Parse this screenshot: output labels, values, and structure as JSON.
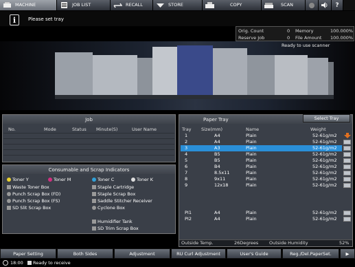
{
  "tabs": [
    {
      "label": "MACHINE"
    },
    {
      "label": "JOB LIST"
    },
    {
      "label": "RECALL"
    },
    {
      "label": "STORE"
    },
    {
      "label": "COPY"
    },
    {
      "label": "SCAN"
    }
  ],
  "message": "Please set tray",
  "counts": {
    "orig_label": "Orig. Count",
    "orig_value": "0",
    "reserve_label": "Reserve Job",
    "reserve_value": "0",
    "memory_label": "Memory",
    "memory_value": "100.000%",
    "file_label": "File Amount",
    "file_value": "100.000%"
  },
  "scanner_status": "Ready to use scanner",
  "job": {
    "title": "Job",
    "headers": [
      "No.",
      "Mode",
      "Status",
      "Minute(S)",
      "User Name"
    ]
  },
  "consumables": {
    "title": "Consumable and Scrap Indicators",
    "items": [
      "Toner Y",
      "Toner M",
      "Toner C",
      "Toner K",
      "Waste Toner Box",
      "Staple Cartridge",
      "Punch Scrap Box (FD)",
      "Staple Scrap Box",
      "Punch Scrap Box (FS)",
      "Saddle Stitcher Receiver",
      "SD Slit Scrap Box",
      "Cyclone Box",
      "Humidifier Tank",
      "SD Trim Scrap Box"
    ]
  },
  "tray": {
    "title": "Paper Tray",
    "select_label": "Select Tray",
    "headers": [
      "Tray",
      "Size(mm)",
      "Name",
      "Weight"
    ],
    "rows": [
      {
        "tray": "1",
        "size": "A4",
        "name": "Plain",
        "weight": "52-61g/m2"
      },
      {
        "tray": "2",
        "size": "A4",
        "name": "Plain",
        "weight": "52-61g/m2"
      },
      {
        "tray": "3",
        "size": "A3",
        "name": "Plain",
        "weight": "52-61g/m2"
      },
      {
        "tray": "4",
        "size": "B5",
        "name": "Plain",
        "weight": "52-61g/m2"
      },
      {
        "tray": "5",
        "size": "B5",
        "name": "Plain",
        "weight": "52-61g/m2"
      },
      {
        "tray": "6",
        "size": "B4",
        "name": "Plain",
        "weight": "52-61g/m2"
      },
      {
        "tray": "7",
        "size": "8.5x11",
        "name": "Plain",
        "weight": "52-61g/m2"
      },
      {
        "tray": "8",
        "size": "9x11",
        "name": "Plain",
        "weight": "52-61g/m2"
      },
      {
        "tray": "9",
        "size": "12x18",
        "name": "Plain",
        "weight": "52-61g/m2"
      },
      {
        "tray": "PI1",
        "size": "A4",
        "name": "Plain",
        "weight": "52-61g/m2"
      },
      {
        "tray": "PI2",
        "size": "A4",
        "name": "Plain",
        "weight": "52-61g/m2"
      }
    ],
    "outside_temp_label": "Outside Temp.",
    "outside_temp_value": "26Degrees",
    "outside_hum_label": "Outside Humidity",
    "outside_hum_value": "52%"
  },
  "buttons": [
    "Paper Setting",
    "Both Sides",
    "Adjustment",
    "RU Curl Adjustment",
    "User's Guide",
    "Reg./Del.PaperSet."
  ],
  "status": {
    "time": "18:00",
    "text": "Ready to receive"
  },
  "colors": {
    "accent": "#2a8fd8",
    "warning": "#e07020"
  }
}
